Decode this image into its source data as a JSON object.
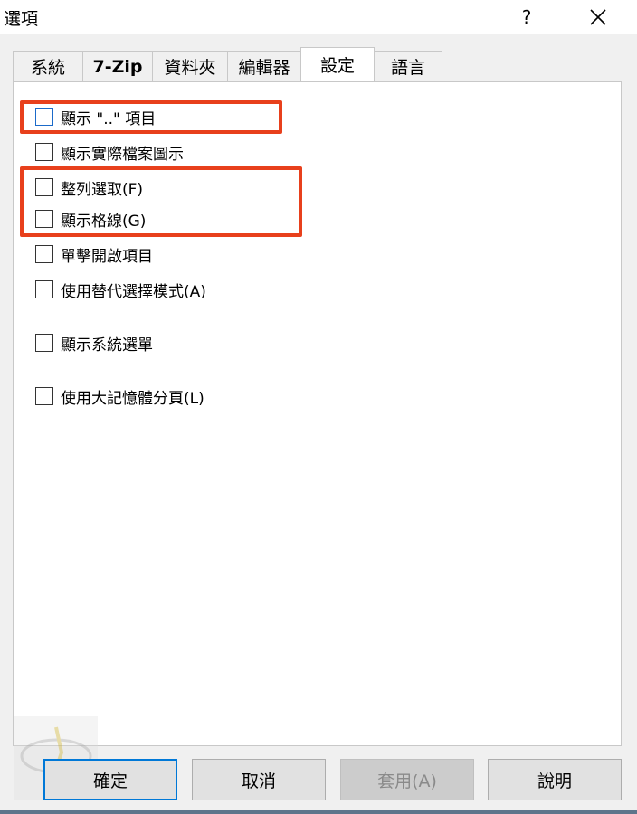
{
  "window": {
    "title": "選項",
    "help_label": "?"
  },
  "tabs": [
    {
      "label": "系統",
      "active": false
    },
    {
      "label": "7-Zip",
      "active": false
    },
    {
      "label": "資料夾",
      "active": false
    },
    {
      "label": "編輯器",
      "active": false
    },
    {
      "label": "設定",
      "active": true
    },
    {
      "label": "語言",
      "active": false
    }
  ],
  "options": [
    {
      "label": "顯示 \"..\" 項目",
      "checked": false
    },
    {
      "label": "顯示實際檔案圖示",
      "checked": false
    },
    {
      "label": "整列選取(F)",
      "checked": false
    },
    {
      "label": "顯示格線(G)",
      "checked": false
    },
    {
      "label": "單擊開啟項目",
      "checked": false
    },
    {
      "label": "使用替代選擇模式(A)",
      "checked": false
    },
    {
      "label": "顯示系統選單",
      "checked": false
    },
    {
      "label": "使用大記憶體分頁(L)",
      "checked": false
    }
  ],
  "buttons": {
    "ok": "確定",
    "cancel": "取消",
    "apply": "套用(A)",
    "help": "說明"
  },
  "colors": {
    "highlight": "#e8401c",
    "focus": "#0078d7"
  }
}
